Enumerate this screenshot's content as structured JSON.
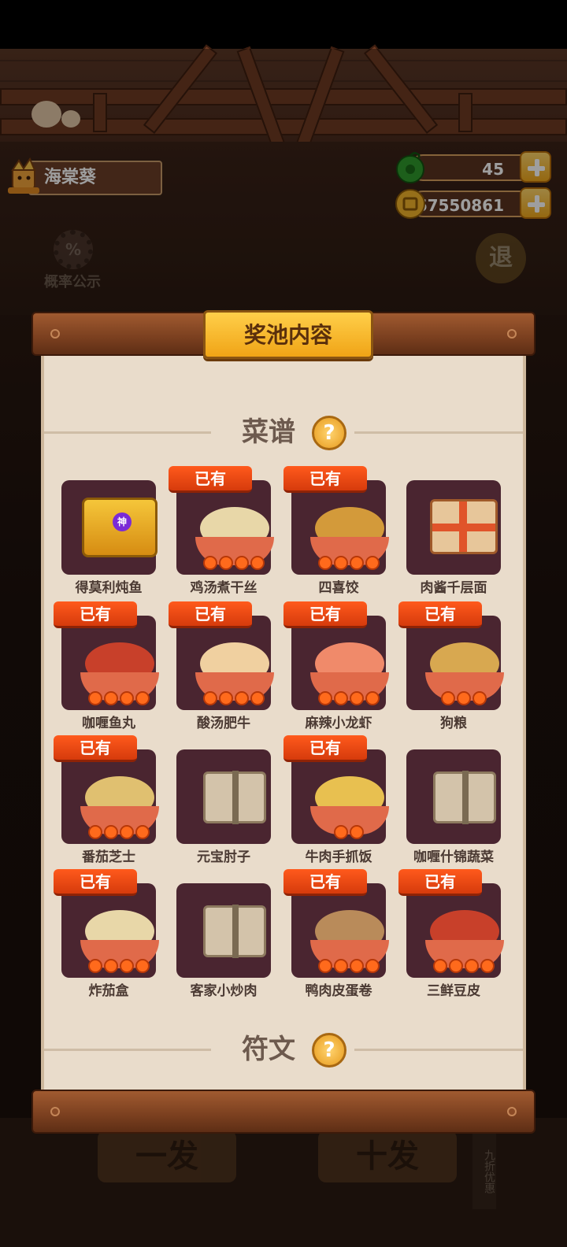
{
  "player": {
    "name": "海棠葵"
  },
  "currencies": [
    {
      "icon": "jade-coin-icon",
      "value": "45",
      "color": "#3bb03a"
    },
    {
      "icon": "gold-coin-icon",
      "value": "67550861",
      "color": "#f2b42a"
    }
  ],
  "background": {
    "probability_label": "概率公示",
    "return_label": "退",
    "pull_one_label": "一发",
    "pull_ten_label": "十发",
    "discount_label": "九折优惠"
  },
  "panel": {
    "title": "奖池内容",
    "sections": [
      {
        "label": "菜谱",
        "help": "?"
      },
      {
        "label": "符文",
        "help": "?"
      }
    ],
    "owned_badge": "已有",
    "recipes": [
      {
        "name": "得莫利炖鱼",
        "owned": false,
        "kind": "chest",
        "stars": 0
      },
      {
        "name": "鸡汤煮干丝",
        "owned": true,
        "kind": "dish",
        "stars": 4
      },
      {
        "name": "四喜饺",
        "owned": true,
        "kind": "dish",
        "stars": 4
      },
      {
        "name": "肉酱千层面",
        "owned": false,
        "kind": "gift",
        "stars": 0
      },
      {
        "name": "咖喱鱼丸",
        "owned": true,
        "kind": "dish",
        "stars": 4
      },
      {
        "name": "酸汤肥牛",
        "owned": true,
        "kind": "dish",
        "stars": 4
      },
      {
        "name": "麻辣小龙虾",
        "owned": true,
        "kind": "dish",
        "stars": 4
      },
      {
        "name": "狗粮",
        "owned": true,
        "kind": "dish",
        "stars": 3
      },
      {
        "name": "番茄芝士",
        "owned": true,
        "kind": "dish",
        "stars": 4
      },
      {
        "name": "元宝肘子",
        "owned": false,
        "kind": "scroll",
        "stars": 0
      },
      {
        "name": "牛肉手抓饭",
        "owned": true,
        "kind": "dish",
        "stars": 2
      },
      {
        "name": "咖喱什锦蔬菜",
        "owned": false,
        "kind": "scroll",
        "stars": 0
      },
      {
        "name": "炸茄盒",
        "owned": true,
        "kind": "dish",
        "stars": 4
      },
      {
        "name": "客家小炒肉",
        "owned": false,
        "kind": "scroll",
        "stars": 0
      },
      {
        "name": "鸭肉皮蛋卷",
        "owned": true,
        "kind": "dish",
        "stars": 4
      },
      {
        "name": "三鲜豆皮",
        "owned": true,
        "kind": "dish",
        "stars": 4
      }
    ]
  }
}
